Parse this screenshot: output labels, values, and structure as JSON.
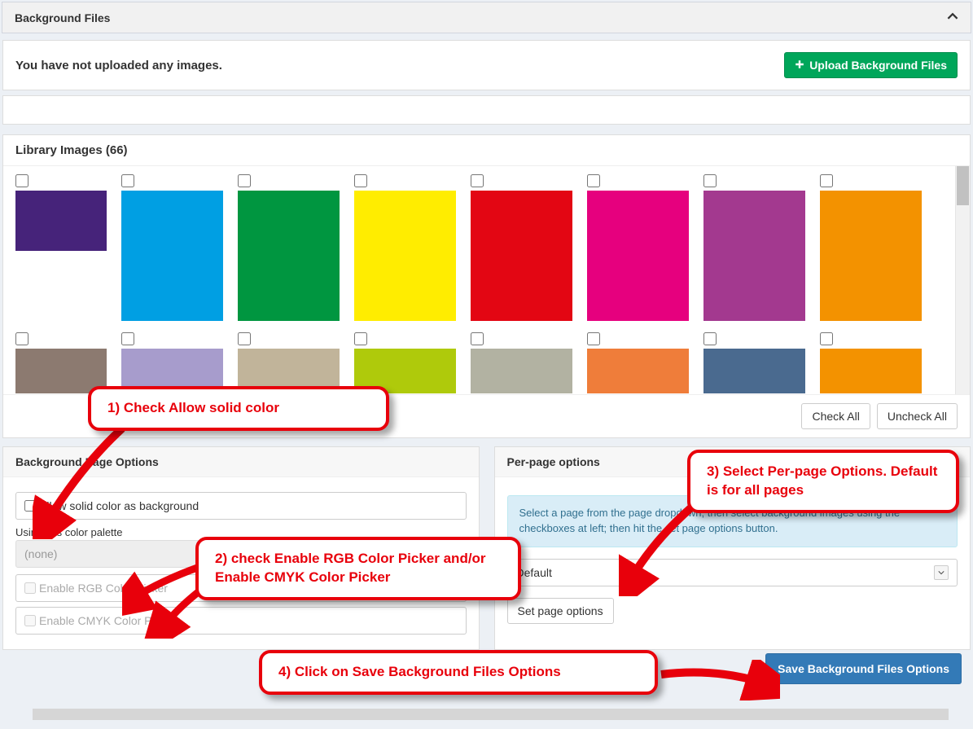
{
  "panel": {
    "title": "Background Files",
    "no_images_msg": "You have not uploaded any images.",
    "upload_btn": "Upload Background Files"
  },
  "library": {
    "title": "Library Images (66)",
    "check_all": "Check All",
    "uncheck_all": "Uncheck All",
    "row1_colors": [
      "#46237a",
      "#009fe3",
      "#009640",
      "#ffed00",
      "#e30613",
      "#e6007e",
      "#a3398f",
      "#f39200"
    ],
    "row2_colors": [
      "#8c7a70",
      "#a79ccc",
      "#c1b49a",
      "#afca0b",
      "#b2b2a2",
      "#ef7d3a",
      "#4a6a8f",
      "#f39200"
    ]
  },
  "bgopts": {
    "title": "Background Page Options",
    "allow_solid": "Allow solid color as background",
    "palette_label": "Using this color palette",
    "palette_value": "(none)",
    "rgb": "Enable RGB Color Picker",
    "cmyk": "Enable CMYK Color Picker"
  },
  "perpage": {
    "title": "Per-page options",
    "info": "Select a page from the page dropdown; then select background images using the checkboxes at left; then hit the set page options button.",
    "select_value": "Default",
    "set_btn": "Set page options"
  },
  "save_btn": "Save Background Files Options",
  "callouts": {
    "c1": "1) Check Allow solid color",
    "c2": "2) check Enable RGB Color Picker and/or Enable CMYK Color Picker",
    "c3": "3) Select Per-page Options. Default is for all pages",
    "c4": "4) Click on Save Background Files Options"
  }
}
